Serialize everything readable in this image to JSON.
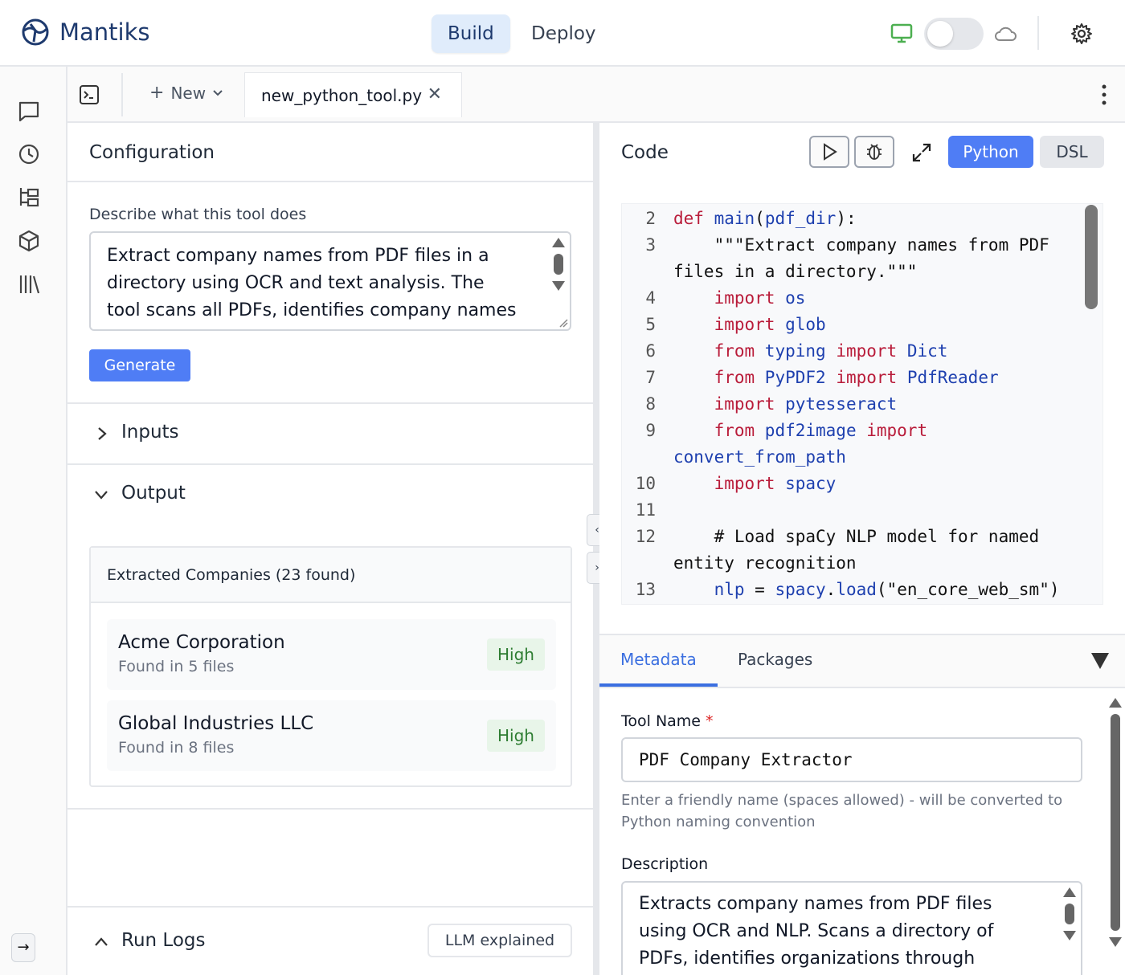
{
  "header": {
    "brand": "Mantiks",
    "modes": [
      {
        "label": "Build",
        "active": true
      },
      {
        "label": "Deploy",
        "active": false
      }
    ],
    "env_toggle_on": false
  },
  "rail": {
    "icons": [
      "chat-icon",
      "history-icon",
      "hierarchy-icon",
      "package-icon",
      "library-icon"
    ],
    "expand_label": "→"
  },
  "tabbar": {
    "new_label": "New",
    "file_tab": "new_python_tool.py"
  },
  "config": {
    "title": "Configuration",
    "describe_label": "Describe what this tool does",
    "describe_value": "Extract company names from PDF files in a directory using OCR and text analysis. The tool scans all PDFs, identifies company names using named entity recognition and NLP and",
    "generate_label": "Generate",
    "inputs_label": "Inputs",
    "output_label": "Output",
    "output_card": {
      "header": "Extracted Companies (23 found)",
      "companies": [
        {
          "name": "Acme Corporation",
          "sub": "Found in 5 files",
          "confidence": "High"
        },
        {
          "name": "Global Industries LLC",
          "sub": "Found in 8 files",
          "confidence": "High"
        }
      ]
    },
    "run_logs_label": "Run Logs",
    "llm_button": "LLM explained"
  },
  "code": {
    "title": "Code",
    "lang_active": "Python",
    "lang_inactive": "DSL",
    "lines": [
      {
        "n": "2",
        "segs": [
          [
            "kw",
            "def "
          ],
          [
            "id",
            "main"
          ],
          [
            "p",
            "("
          ],
          [
            "id",
            "pdf_dir"
          ],
          [
            "p",
            "):"
          ]
        ]
      },
      {
        "n": "3",
        "segs": [
          [
            "p",
            "    \"\"\"Extract company names from PDF"
          ]
        ]
      },
      {
        "n": "",
        "segs": [
          [
            "p",
            "files in a directory.\"\"\""
          ]
        ],
        "wrap": true
      },
      {
        "n": "4",
        "segs": [
          [
            "p",
            "    "
          ],
          [
            "kw",
            "import "
          ],
          [
            "id",
            "os"
          ]
        ]
      },
      {
        "n": "5",
        "segs": [
          [
            "p",
            "    "
          ],
          [
            "kw",
            "import "
          ],
          [
            "id",
            "glob"
          ]
        ]
      },
      {
        "n": "6",
        "segs": [
          [
            "p",
            "    "
          ],
          [
            "kw",
            "from "
          ],
          [
            "id",
            "typing "
          ],
          [
            "kw",
            "import "
          ],
          [
            "id",
            "Dict"
          ]
        ]
      },
      {
        "n": "7",
        "segs": [
          [
            "p",
            "    "
          ],
          [
            "kw",
            "from "
          ],
          [
            "id",
            "PyPDF2 "
          ],
          [
            "kw",
            "import "
          ],
          [
            "id",
            "PdfReader"
          ]
        ]
      },
      {
        "n": "8",
        "segs": [
          [
            "p",
            "    "
          ],
          [
            "kw",
            "import "
          ],
          [
            "id",
            "pytesseract"
          ]
        ]
      },
      {
        "n": "9",
        "segs": [
          [
            "p",
            "    "
          ],
          [
            "kw",
            "from "
          ],
          [
            "id",
            "pdf2image "
          ],
          [
            "kw",
            "import"
          ]
        ]
      },
      {
        "n": "",
        "segs": [
          [
            "id",
            "convert_from_path"
          ]
        ],
        "wrap": true
      },
      {
        "n": "10",
        "segs": [
          [
            "p",
            "    "
          ],
          [
            "kw",
            "import "
          ],
          [
            "id",
            "spacy"
          ]
        ]
      },
      {
        "n": "11",
        "segs": [
          [
            "p",
            ""
          ]
        ]
      },
      {
        "n": "12",
        "segs": [
          [
            "p",
            "    # Load spaCy NLP model for named"
          ]
        ]
      },
      {
        "n": "",
        "segs": [
          [
            "p",
            "entity recognition"
          ]
        ],
        "wrap": true
      },
      {
        "n": "13",
        "segs": [
          [
            "p",
            "    "
          ],
          [
            "id",
            "nlp "
          ],
          [
            "p",
            "= "
          ],
          [
            "id",
            "spacy"
          ],
          [
            "p",
            "."
          ],
          [
            "id",
            "load"
          ],
          [
            "p",
            "(\"en_core_web_sm\")"
          ]
        ]
      }
    ]
  },
  "metadata": {
    "tabs": [
      "Metadata",
      "Packages"
    ],
    "tool_name_label": "Tool Name",
    "required_mark": "*",
    "tool_name_value": "PDF Company Extractor",
    "tool_name_hint": "Enter a friendly name (spaces allowed) - will be converted to Python naming convention",
    "description_label": "Description",
    "description_value": "Extracts company names from PDF files using OCR and NLP. Scans a directory of PDFs, identifies organizations through named entity recognition"
  }
}
